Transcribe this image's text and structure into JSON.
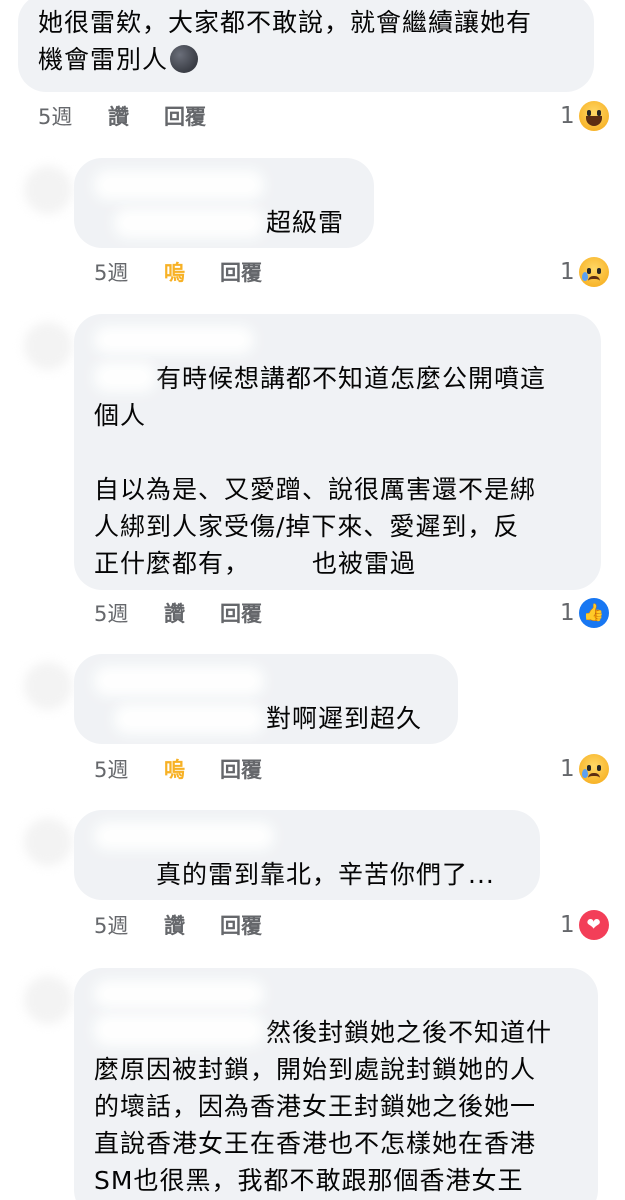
{
  "comments": [
    {
      "text_lines": [
        "她很雷欸，大家都不敢說，就會繼續讓她有",
        "機會雷別人"
      ],
      "emoji_inline": "moon-face-icon",
      "time": "5週",
      "like_label": "讚",
      "reply_label": "回覆",
      "reaction_count": "1",
      "reaction": "haha"
    },
    {
      "text_lines": [
        "超級雷"
      ],
      "time": "5週",
      "like_label": "嗚",
      "reply_label": "回覆",
      "reaction_count": "1",
      "reaction": "sad"
    },
    {
      "text_lines": [
        "有時候想講都不知道怎麼公開噴這",
        "個人",
        "",
        "自以為是、又愛蹭、說很厲害還不是綁",
        "人綁到人家受傷/掉下來、愛遲到，反",
        "正什麼都有，",
        "也被雷過"
      ],
      "time": "5週",
      "like_label": "讚",
      "reply_label": "回覆",
      "reaction_count": "1",
      "reaction": "like"
    },
    {
      "text_lines": [
        "對啊遲到超久"
      ],
      "time": "5週",
      "like_label": "嗚",
      "reply_label": "回覆",
      "reaction_count": "1",
      "reaction": "sad"
    },
    {
      "text_lines": [
        "真的雷到靠北，辛苦你們了..."
      ],
      "time": "5週",
      "like_label": "讚",
      "reply_label": "回覆",
      "reaction_count": "1",
      "reaction": "love"
    },
    {
      "text_lines": [
        "然後封鎖她之後不知道什",
        "麼原因被封鎖，開始到處說封鎖她的人",
        "的壞話，因為香港女王封鎖她之後她一",
        "直說香港女王在香港也不怎樣她在香港",
        "SM也很黑，我都不敢跟那個香港女王"
      ]
    }
  ]
}
